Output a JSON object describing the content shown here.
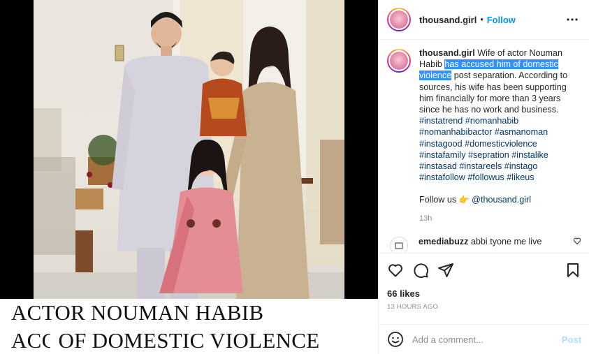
{
  "media": {
    "caption_line1": "ACTOR NOUMAN HABIB ACCUSED",
    "caption_line2": "OF DOMESTIC VIOLENCE"
  },
  "header": {
    "username": "thousand.girl",
    "separator": "•",
    "follow_label": "Follow",
    "more_icon": "more-horizontal-icon"
  },
  "caption": {
    "username": "thousand.girl",
    "text_before": "Wife of actor Nouman Habib ",
    "text_selected": "has accused him of domestic violence",
    "text_after": " post separation. According to sources, his wife has been supporting him financially for more than 3 years since he has no work and business.",
    "hashtags": "#instatrend #nomanhabib #nomanhabibactor #asmanoman #instagood #domesticviolence #instafamily #sepration #instalike #instasad #instareels #instago #instafollow #followus #likeus",
    "follow_us_text": "Follow us",
    "hand_emoji": "👉",
    "mention": "@thousand.girl",
    "time": "13h"
  },
  "comment": {
    "username": "emediabuzz",
    "text": "abbi tyone me live"
  },
  "actions": {
    "like_icon": "heart-icon",
    "comment_icon": "comment-icon",
    "share_icon": "share-icon",
    "save_icon": "bookmark-icon",
    "likes": "66 likes",
    "posted_ago": "13 HOURS AGO"
  },
  "add_comment": {
    "placeholder": "Add a comment...",
    "post_label": "Post"
  },
  "colors": {
    "link_blue": "#0095f6",
    "hashtag": "#00376b",
    "selection": "#3390ff",
    "muted": "#8e8e8e"
  }
}
